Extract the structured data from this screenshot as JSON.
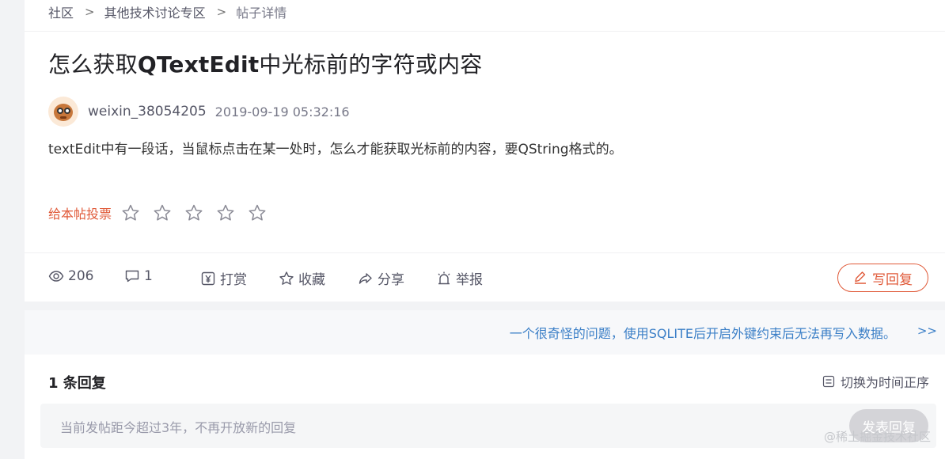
{
  "breadcrumb": {
    "items": [
      "社区",
      "其他技术讨论专区",
      "帖子详情"
    ],
    "separator": ">"
  },
  "post": {
    "title_prefix": "怎么获取",
    "title_code": "QTextEdit",
    "title_suffix": "中光标前的字符或内容",
    "author": "weixin_38054205",
    "time": "2019-09-19 05:32:16",
    "content": "textEdit中有一段话，当鼠标点击在某一处时，怎么才能获取光标前的内容，要QString格式的。"
  },
  "vote": {
    "label": "给本帖投票",
    "stars_total": 5,
    "stars_filled": 0
  },
  "actions": {
    "views": "206",
    "comments": "1",
    "reward": "打赏",
    "favorite": "收藏",
    "share": "分享",
    "report": "举报",
    "reply": "写回复"
  },
  "next_post": {
    "title": "一个很奇怪的问题，使用SQLITE后开启外键约束后无法再写入数据。",
    "arrow": ">>"
  },
  "replies": {
    "count_label": "1 条回复",
    "sort_label": "切换为时间正序",
    "placeholder": "当前发帖距今超过3年，不再开放新的回复",
    "publish_label": "发表回复"
  },
  "watermark": "@稀土掘金技术社区",
  "colors": {
    "accent": "#e05a39",
    "link": "#3b7fc7",
    "muted": "#777888"
  }
}
